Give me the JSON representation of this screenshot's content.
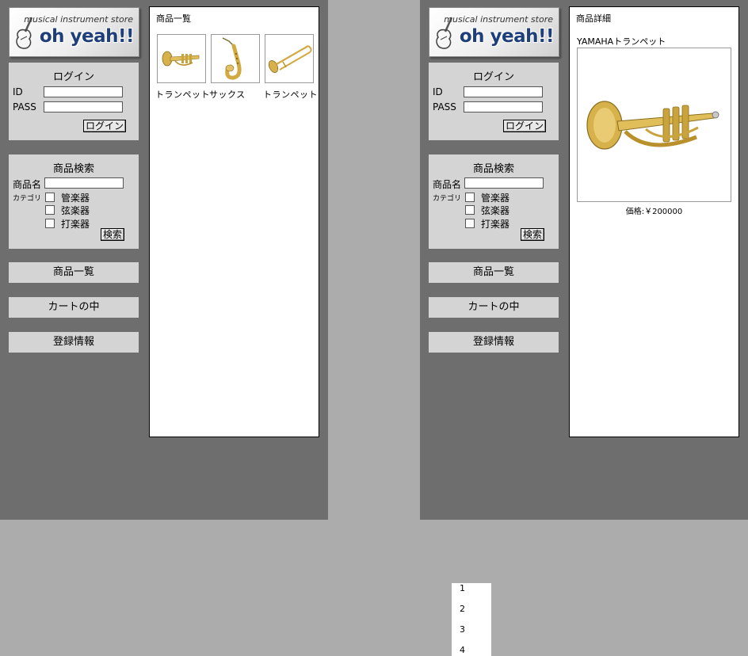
{
  "store": {
    "tagline": "musical instrument store",
    "name": "oh yeah!!"
  },
  "colors": {
    "background": "#acacac",
    "panel": "#6e6e6e",
    "box": "#d4d4d4",
    "logo_text": "#1e3f7a"
  },
  "login": {
    "title": "ログイン",
    "id_label": "ID",
    "pass_label": "PASS",
    "id_value": "",
    "pass_value": "",
    "submit_label": "ログイン"
  },
  "search": {
    "title": "商品検索",
    "name_label": "商品名",
    "name_value": "",
    "category_label": "カテゴリ",
    "categories": [
      "管楽器",
      "弦楽器",
      "打楽器"
    ],
    "submit_label": "検索"
  },
  "nav": {
    "product_list": "商品一覧",
    "cart": "カートの中",
    "registration": "登録情報"
  },
  "list_page": {
    "title": "商品一覧",
    "products": [
      {
        "name": "トランペット",
        "icon": "trumpet-image"
      },
      {
        "name": "サックス",
        "icon": "saxophone-image"
      },
      {
        "name": "トランペット",
        "icon": "trombone-image"
      }
    ]
  },
  "detail_page": {
    "title": "商品詳細",
    "product_name": "YAMAHAトランペット",
    "price": "価格:￥200000"
  },
  "pagination": [
    "1",
    "2",
    "3",
    "4"
  ]
}
